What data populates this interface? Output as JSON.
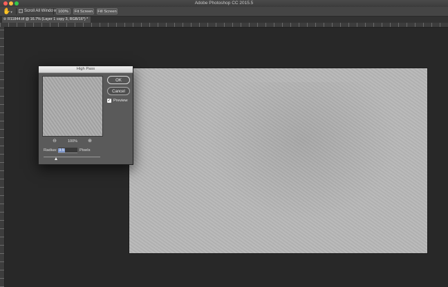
{
  "window": {
    "title": "Adobe Photoshop CC 2015.5"
  },
  "options_bar": {
    "tool_icon": "hand-icon",
    "scroll_all_windows_label": "Scroll All Windows",
    "scroll_all_windows_checked": false,
    "buttons": [
      "100%",
      "Fit Screen",
      "Fill Screen"
    ]
  },
  "document_tab": {
    "label": "R11844.tif @ 16.7% (Layer 1 copy 3, RGB/16*) *"
  },
  "high_pass_dialog": {
    "title": "High Pass",
    "ok_label": "OK",
    "cancel_label": "Cancel",
    "preview_label": "Preview",
    "preview_checked": true,
    "zoom_level": "100%",
    "radius_label": "Radius:",
    "radius_value": "3.5",
    "radius_unit": "Pixels",
    "slider_fraction": 0.22
  }
}
